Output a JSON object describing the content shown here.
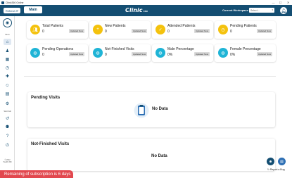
{
  "window": {
    "title": "Clinic360 Online",
    "min": "—",
    "max": "☐",
    "close": "✕"
  },
  "header": {
    "refresh_label": "Refresh",
    "refresh_icon": "refresh-icon",
    "main_label": "Main",
    "logo_text": "Clinic",
    "logo_suffix": "360",
    "workspace_label": "Current Workspace",
    "workspace_value": "Select...",
    "notification_icon": "bell-icon",
    "brand_color": "#144e72"
  },
  "sidebar": {
    "menu_label": "Menu",
    "start_label": "Start Call",
    "footer_line1": "© 2022",
    "footer_line2": "Health 360",
    "icons": [
      "home-icon",
      "patients-icon",
      "calendar-icon",
      "clock-icon",
      "medical-icon",
      "users-icon",
      "receipt-icon",
      "settings-icon",
      "history-icon",
      "org-icon",
      "help-icon",
      "logout-icon"
    ]
  },
  "stats": [
    {
      "label": "Total Patients",
      "value": "0",
      "badge": "Updated Now",
      "icon": "patients-icon",
      "color": "#f4c20d"
    },
    {
      "label": "New Patients",
      "value": "0",
      "badge": "Updated Now",
      "icon": "user-plus-icon",
      "color": "#f4c20d"
    },
    {
      "label": "Attended Patients",
      "value": "0",
      "badge": "Updated Now",
      "icon": "user-check-icon",
      "color": "#f4c20d"
    },
    {
      "label": "Pending Patients",
      "value": "0",
      "badge": "Updated Now",
      "icon": "user-clock-icon",
      "color": "#f4c20d"
    },
    {
      "label": "Pending Operations",
      "value": "0",
      "badge": "Updated Now",
      "icon": "globe-icon",
      "color": "#1fb4d6"
    },
    {
      "label": "Not-Finished Visits",
      "value": "0",
      "badge": "Updated Now",
      "icon": "globe-icon",
      "color": "#1fb4d6"
    },
    {
      "label": "Male Percentage",
      "value": "0%",
      "badge": "Updated Now",
      "icon": "globe-icon",
      "color": "#1fb4d6"
    },
    {
      "label": "Female Percentage",
      "value": "0%",
      "badge": "Updated Now",
      "icon": "globe-icon",
      "color": "#1fb4d6"
    }
  ],
  "pending_visits": {
    "title": "Pending Visits",
    "empty": "No Data",
    "icon": "empty-clipboard-icon"
  },
  "not_finished_visits": {
    "title": "Not-Finished Visits",
    "empty": "No Data"
  },
  "subscription": {
    "text": "Remaining of subscription is 6 days",
    "color": "#e2484f"
  },
  "floating": {
    "chat_icon": "support-icon",
    "message_icon": "message-icon",
    "report_label": "Report a Bug"
  }
}
